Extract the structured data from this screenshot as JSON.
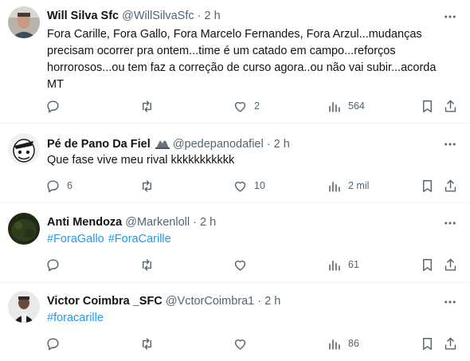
{
  "tweets": [
    {
      "name": "Will Silva Sfc",
      "handle": "@WillSilvaSfc",
      "dot": "·",
      "time": "2 h",
      "text_lines": [
        "Fora Carille, Fora Gallo, Fora Marcelo Fernandes, Fora Arzul...mudanças",
        "precisam ocorrer pra ontem...time é um catado em campo...reforços",
        "horrorosos...ou tem faz a correção de curso agora..ou não vai subir...acorda",
        "MT"
      ],
      "replies": "",
      "retweets": "",
      "likes": "2",
      "views": "564"
    },
    {
      "name": "Pé de Pano Da Fiel",
      "handle": "@pedepanodafiel",
      "dot": "·",
      "time": "2 h",
      "text": "Que fase vive meu rival kkkkkkkkkkk",
      "replies": "6",
      "retweets": "",
      "likes": "10",
      "views": "2 mil"
    },
    {
      "name": "Anti Mendoza",
      "handle": "@Markenloll",
      "dot": "·",
      "time": "2 h",
      "hashtags": [
        "#ForaGallo",
        "#ForaCarille"
      ],
      "replies": "",
      "retweets": "",
      "likes": "",
      "views": "61"
    },
    {
      "name": "Victor Coimbra _SFC",
      "handle": "@VctorCoimbra1",
      "dot": "·",
      "time": "2 h",
      "hashtags": [
        "#foracarille"
      ],
      "replies": "",
      "retweets": "",
      "likes": "",
      "views": "86"
    }
  ],
  "icons": {
    "reply": "reply-icon",
    "retweet": "retweet-icon",
    "like": "like-icon",
    "views": "views-icon",
    "bookmark": "bookmark-icon",
    "share": "share-icon",
    "more": "more-icon"
  },
  "colors": {
    "text": "#0f1419",
    "secondary": "#536471",
    "hashtag": "#1d9bf0",
    "divider": "#eff3f4"
  }
}
